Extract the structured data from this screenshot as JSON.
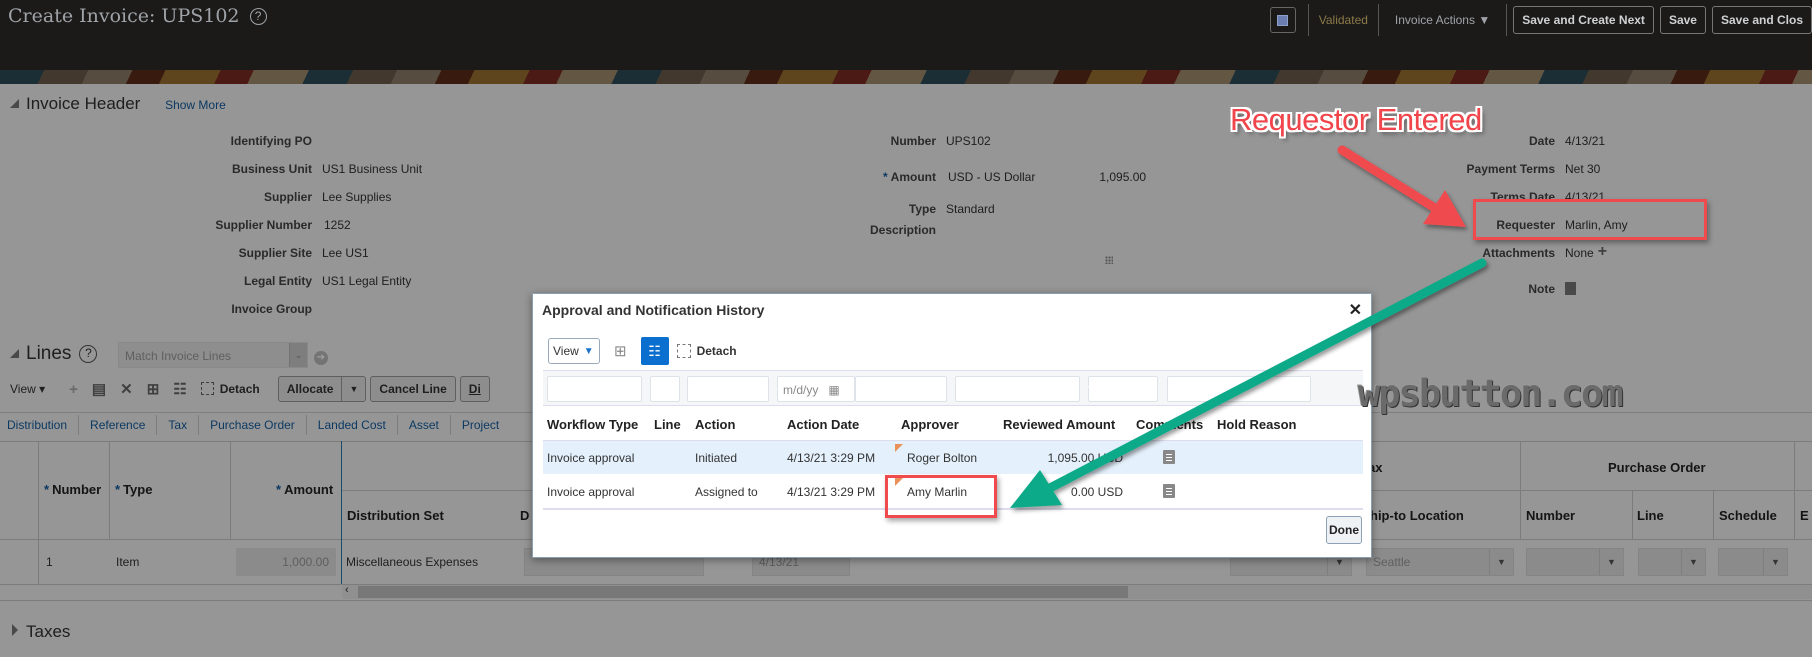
{
  "header": {
    "title": "Create Invoice: UPS102",
    "help_icon": "question-circle-icon",
    "status": "Validated",
    "invoice_actions": "Invoice Actions",
    "save_and_create_next": "Save and Create Next",
    "save": "Save",
    "save_and_close": "Save and Clos"
  },
  "invoice_header": {
    "title": "Invoice Header",
    "show_more": "Show More",
    "left_fields": [
      {
        "label": "Identifying PO",
        "value": ""
      },
      {
        "label": "Business Unit",
        "value": "US1 Business Unit"
      },
      {
        "label": "Supplier",
        "value": "Lee Supplies"
      },
      {
        "label": "Supplier Number",
        "value": "1252"
      },
      {
        "label": "Supplier Site",
        "value": "Lee US1"
      },
      {
        "label": "Legal Entity",
        "value": "US1 Legal Entity"
      },
      {
        "label": "Invoice Group",
        "value": ""
      }
    ],
    "middle_fields": {
      "number_label": "Number",
      "number_value": "UPS102",
      "amount_label": "Amount",
      "amount_currency": "USD - US Dollar",
      "amount_value": "1,095.00",
      "type_label": "Type",
      "type_value": "Standard",
      "description_label": "Description",
      "description_value": ""
    },
    "right_fields": {
      "date_label": "Date",
      "date_value": "4/13/21",
      "payment_terms_label": "Payment Terms",
      "payment_terms_value": "Net 30",
      "terms_date_label": "Terms Date",
      "terms_date_value": "4/13/21",
      "requester_label": "Requester",
      "requester_value": "Marlin, Amy",
      "attachments_label": "Attachments",
      "attachments_value": "None",
      "note_label": "Note"
    },
    "required_mark": "*"
  },
  "lines": {
    "title": "Lines",
    "match_placeholder": "Match Invoice Lines",
    "toolbar": {
      "view": "View",
      "detach": "Detach",
      "allocate": "Allocate",
      "cancel_line": "Cancel Line",
      "dis": "Di"
    },
    "tabs": [
      "Distribution",
      "Reference",
      "Tax",
      "Purchase Order",
      "Landed Cost",
      "Asset",
      "Project"
    ],
    "columns": {
      "number": "Number",
      "type": "Type",
      "amount": "Amount",
      "distribution_set": "Distribution Set",
      "d": "D",
      "tax_partial": "ax",
      "ship_to_location": "hip-to Location",
      "purchase_order_group": "Purchase Order",
      "po_number": "Number",
      "po_line": "Line",
      "po_schedule": "Schedule",
      "en": "E"
    },
    "rows": [
      {
        "number": "1",
        "type": "Item",
        "amount": "1,000.00",
        "distribution_set": "Miscellaneous Expenses",
        "date": "4/13/21",
        "ship_to_location": "Seattle"
      }
    ]
  },
  "taxes": {
    "title": "Taxes"
  },
  "dialog": {
    "title": "Approval and Notification History",
    "view": "View",
    "detach": "Detach",
    "date_placeholder": "m/d/yy",
    "columns": [
      "Workflow Type",
      "Line",
      "Action",
      "Action Date",
      "Approver",
      "Reviewed Amount",
      "Comments",
      "Hold Reason"
    ],
    "rows": [
      {
        "workflow_type": "Invoice approval",
        "line": "",
        "action": "Initiated",
        "action_date": "4/13/21 3:29 PM",
        "approver": "Roger Bolton",
        "reviewed_amount": "1,095.00 USD",
        "hold_reason": ""
      },
      {
        "workflow_type": "Invoice approval",
        "line": "",
        "action": "Assigned to",
        "action_date": "4/13/21 3:29 PM",
        "approver": "Amy Marlin",
        "reviewed_amount": "0.00 USD",
        "hold_reason": ""
      }
    ],
    "done": "Done"
  },
  "annotations": {
    "callout": "Requestor Entered",
    "watermark": "wpsbutton.com",
    "colors": {
      "red": "#ef4b4f",
      "green": "#0aaa8a"
    }
  }
}
